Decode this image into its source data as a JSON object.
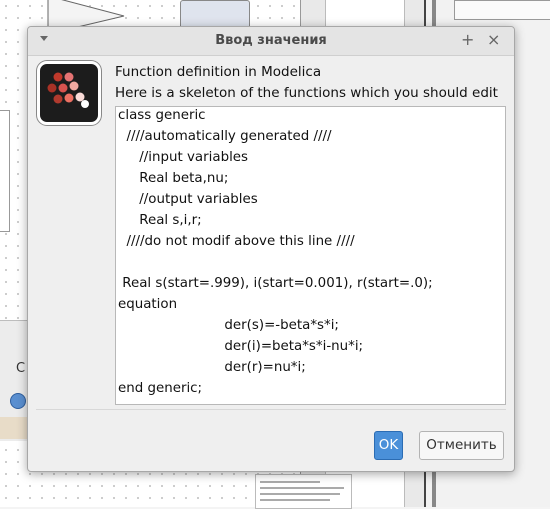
{
  "dialog": {
    "title": "Ввод значения",
    "maximize_glyph": "+",
    "close_glyph": "×",
    "icon": "app-logo-dots-icon",
    "message_line1": "Function definition in Modelica",
    "message_line2": "Here is a skeleton of the functions which you should edit",
    "code_lines": [
      "class generic",
      "  ////automatically generated ////",
      "     //input variables",
      "     Real beta,nu;",
      "     //output variables",
      "     Real s,i,r;",
      "  ////do not modif above this line ////",
      "",
      " Real s(start=.999), i(start=0.001), r(start=.0);",
      "equation",
      "                         der(s)=-beta*s*i;",
      "                         der(i)=beta*s*i-nu*i;",
      "                         der(r)=nu*i;",
      "end generic;"
    ],
    "ok_label": "OK",
    "cancel_label": "Отменить"
  },
  "background": {
    "left_panel_letter": "C",
    "zoom_icon": "zoom-in-icon"
  },
  "colors": {
    "accent": "#4a90d9",
    "title_bar": "#e4e4e4",
    "dialog_bg": "#efefef"
  }
}
